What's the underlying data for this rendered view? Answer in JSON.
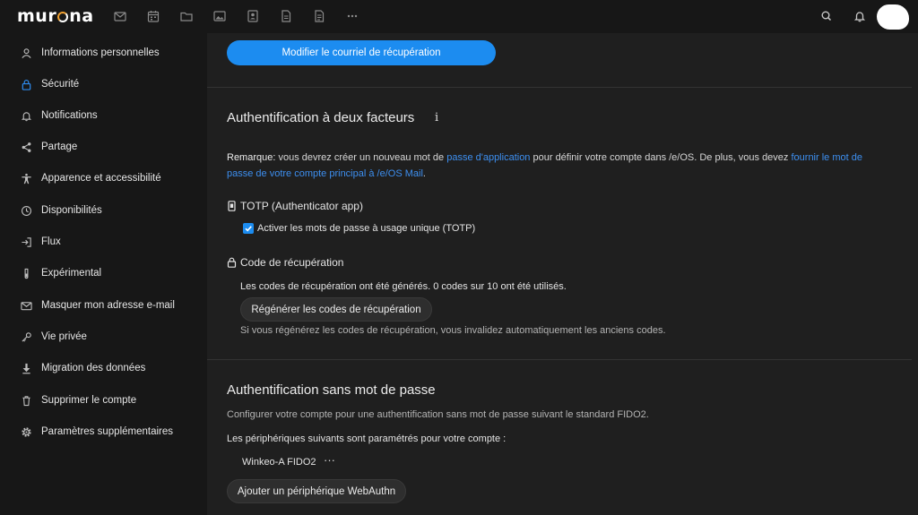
{
  "header": {
    "logo_text": "murena",
    "apps": [
      {
        "icon": "mail-icon"
      },
      {
        "icon": "calendar-icon"
      },
      {
        "icon": "folder-icon"
      },
      {
        "icon": "photos-icon"
      },
      {
        "icon": "contacts-icon"
      },
      {
        "icon": "document-icon"
      },
      {
        "icon": "notes-icon"
      },
      {
        "icon": "more-apps-icon",
        "label": "···"
      }
    ]
  },
  "sidebar": {
    "items": [
      {
        "label": "Informations personnelles",
        "icon": "user-icon"
      },
      {
        "label": "Sécurité",
        "icon": "lock-icon",
        "active": true
      },
      {
        "label": "Notifications",
        "icon": "bell-icon"
      },
      {
        "label": "Partage",
        "icon": "share-icon"
      },
      {
        "label": "Apparence et accessibilité",
        "icon": "accessibility-icon"
      },
      {
        "label": "Disponibilités",
        "icon": "clock-icon"
      },
      {
        "label": "Flux",
        "icon": "login-icon"
      },
      {
        "label": "Expérimental",
        "icon": "flask-icon"
      },
      {
        "label": "Masquer mon adresse e-mail",
        "icon": "mail-icon"
      },
      {
        "label": "Vie privée",
        "icon": "key-icon"
      },
      {
        "label": "Migration des données",
        "icon": "download-icon"
      },
      {
        "label": "Supprimer le compte",
        "icon": "trash-icon"
      },
      {
        "label": "Paramètres supplémentaires",
        "icon": "gear-icon"
      }
    ]
  },
  "main": {
    "recovery_email_button": "Modifier le courriel de récupération",
    "twofa": {
      "title": "Authentification à deux facteurs",
      "info_glyph": "i",
      "note_label": "Remarque:",
      "note_text_1": " vous devrez créer un nouveau mot de ",
      "note_link_1": "passe d'application",
      "note_text_2": " pour définir votre compte dans /e/OS. De plus, vous devez ",
      "note_link_2": "fournir le mot de passe de votre compte principal à /e/OS Mail",
      "note_text_3": ".",
      "totp_heading": "TOTP (Authenticator app)",
      "totp_checkbox_label": "Activer les mots de passe à usage unique (TOTP)",
      "totp_checked": true,
      "recovery_heading": "Code de récupération",
      "recovery_status": "Les codes de récupération ont été générés. 0 codes sur 10 ont été utilisés.",
      "regenerate_button": "Régénérer les codes de récupération",
      "regenerate_hint": "Si vous régénérez les codes de récupération, vous invalidez automatiquement les anciens codes."
    },
    "passwordless": {
      "title": "Authentification sans mot de passe",
      "description": "Configurer votre compte pour une authentification sans mot de passe suivant le standard FIDO2.",
      "devices_label": "Les périphériques suivants sont paramétrés pour votre compte :",
      "devices": [
        {
          "name": "Winkeo-A FIDO2",
          "menu": "···"
        }
      ],
      "add_button": "Ajouter un périphérique WebAuthn"
    }
  },
  "colors": {
    "accent": "#1c8cf0",
    "link": "#3d8ff0",
    "background": "#1f1f1f",
    "sidebar": "#171717"
  }
}
